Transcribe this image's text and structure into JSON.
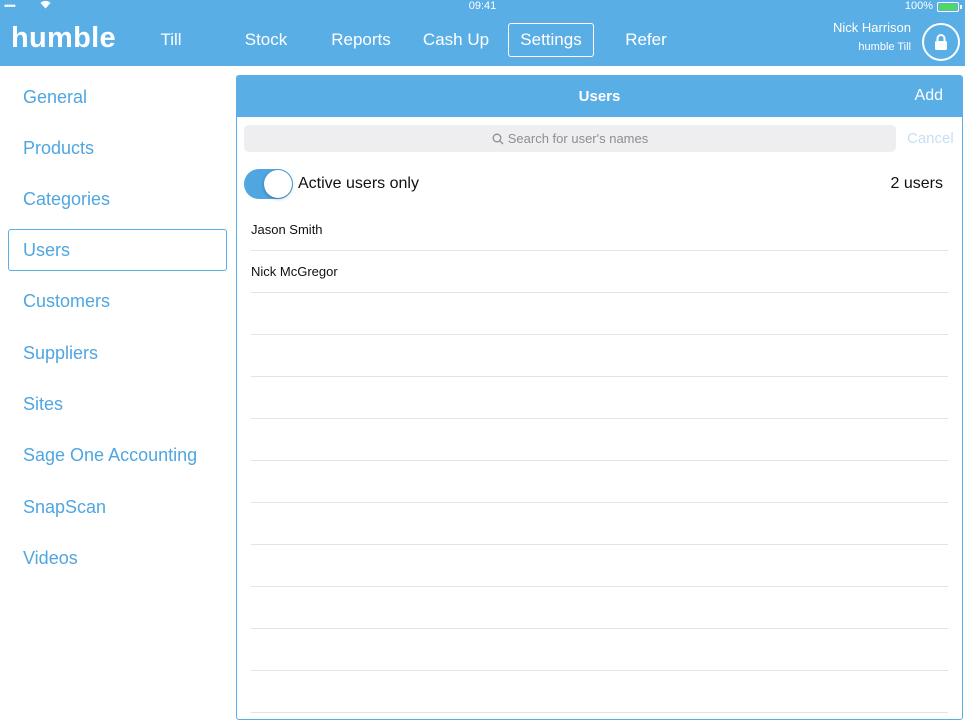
{
  "status_bar": {
    "signal": "•••••",
    "time": "09:41",
    "battery": "100%"
  },
  "app": {
    "logo": "humble"
  },
  "nav": [
    {
      "label": "Till"
    },
    {
      "label": "Stock"
    },
    {
      "label": "Reports"
    },
    {
      "label": "Cash Up"
    },
    {
      "label": "Settings",
      "active": true
    },
    {
      "label": "Refer"
    }
  ],
  "user": {
    "name": "Nick Harrison",
    "device": "humble Till",
    "lock_icon": "lock-icon"
  },
  "sidebar": {
    "items": [
      {
        "label": "General"
      },
      {
        "label": "Products"
      },
      {
        "label": "Categories"
      },
      {
        "label": "Users",
        "active": true
      },
      {
        "label": "Customers"
      },
      {
        "label": "Suppliers"
      },
      {
        "label": "Sites"
      },
      {
        "label": "Sage One Accounting"
      },
      {
        "label": "SnapScan"
      },
      {
        "label": "Videos"
      }
    ]
  },
  "panel": {
    "title": "Users",
    "add_label": "Add",
    "search_placeholder": "Search for user's names",
    "cancel_label": "Cancel",
    "active_toggle_label": "Active users only",
    "active_toggle_on": true,
    "user_count": "2 users",
    "users": [
      {
        "name": "Jason Smith"
      },
      {
        "name": "Nick McGregor"
      }
    ]
  },
  "colors": {
    "accent": "#5aaee6",
    "link": "#4fa6e0",
    "battery": "#4cd964"
  }
}
